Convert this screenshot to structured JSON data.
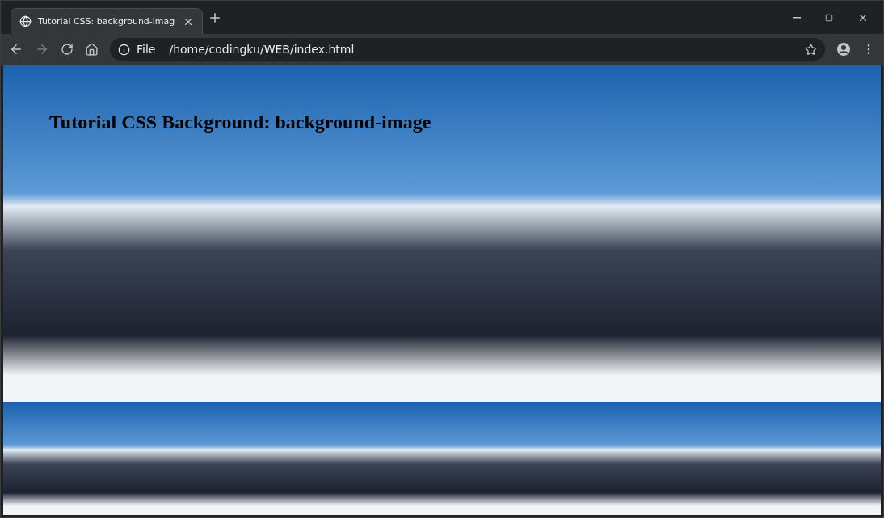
{
  "tabs": [
    {
      "title": "Tutorial CSS: background-imag",
      "selected": true
    }
  ],
  "address_bar": {
    "scheme": "File",
    "url": "/home/codingku/WEB/index.html"
  },
  "page": {
    "heading": "Tutorial CSS Background: background-image"
  }
}
